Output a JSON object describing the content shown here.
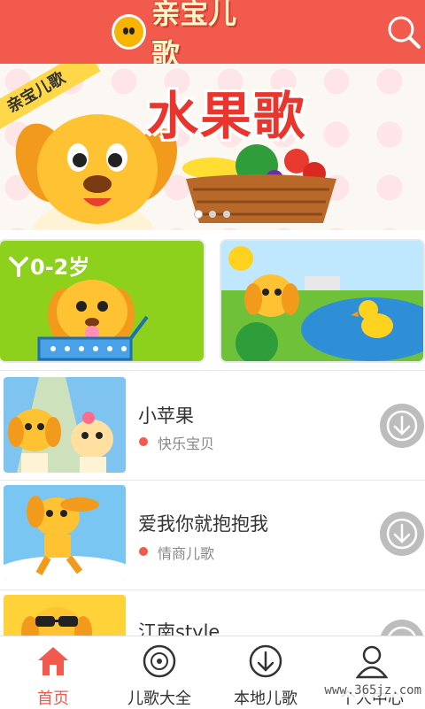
{
  "header": {
    "title": "亲宝儿歌",
    "search_icon": "search-icon"
  },
  "banner": {
    "ribbon_text": "亲宝儿歌",
    "title": "水果歌",
    "page_count": 3,
    "active_page": 1
  },
  "promos": {
    "left_age": "0-2岁"
  },
  "songs": [
    {
      "title": "小苹果",
      "category": "快乐宝贝"
    },
    {
      "title": "爱我你就抱抱我",
      "category": "情商儿歌"
    },
    {
      "title": "江南style",
      "category": ""
    }
  ],
  "nav": [
    {
      "label": "首页",
      "icon": "home-icon",
      "active": true
    },
    {
      "label": "儿歌大全",
      "icon": "disc-icon",
      "active": false
    },
    {
      "label": "本地儿歌",
      "icon": "download-icon",
      "active": false
    },
    {
      "label": "个人中心",
      "icon": "user-icon",
      "active": false
    }
  ],
  "watermark": "www.365jz.com",
  "colors": {
    "primary": "#f25a4d",
    "download_button": "#bdbdbd"
  }
}
